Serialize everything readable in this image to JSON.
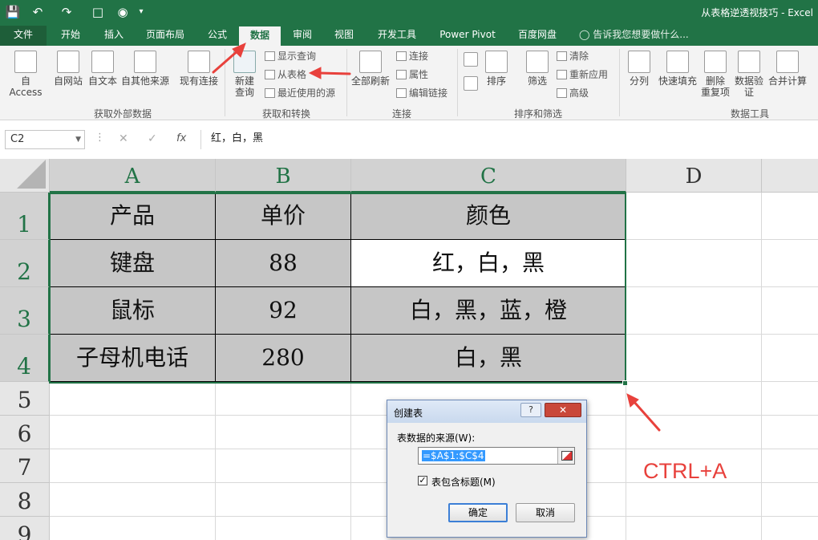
{
  "window": {
    "title": "从表格逆透视技巧 - Excel"
  },
  "ribbon_tabs": [
    "文件",
    "开始",
    "插入",
    "页面布局",
    "公式",
    "数据",
    "审阅",
    "视图",
    "开发工具",
    "Power Pivot",
    "百度网盘"
  ],
  "active_tab": "数据",
  "tell_me": "告诉我您想要做什么...",
  "ribbon": {
    "external": {
      "buttons": [
        "自 Access",
        "自网站",
        "自文本",
        "自其他来源",
        "现有连接"
      ],
      "label": "获取外部数据"
    },
    "transform": {
      "new_query_line1": "新建",
      "new_query_line2": "查询",
      "show_queries": "显示查询",
      "from_table": "从表格",
      "recent_sources": "最近使用的源",
      "label": "获取和转换"
    },
    "connections": {
      "refresh_all": "全部刷新",
      "connections": "连接",
      "properties": "属性",
      "edit_links": "编辑链接",
      "label": "连接"
    },
    "sort_filter": {
      "sort": "排序",
      "filter": "筛选",
      "clear": "清除",
      "reapply": "重新应用",
      "advanced": "高级",
      "label": "排序和筛选"
    },
    "data_tools": {
      "split": "分列",
      "flash_fill": "快速填充",
      "remove_dup_line1": "删除",
      "remove_dup_line2": "重复项",
      "validation_line1": "数据验",
      "validation_line2": "证",
      "consolidate": "合并计算",
      "label": "数据工具"
    }
  },
  "formula_bar": {
    "name_box": "C2",
    "fx": "fx",
    "formula": "红，白，黑"
  },
  "columns": [
    "A",
    "B",
    "C",
    "D"
  ],
  "rows": [
    "1",
    "2",
    "3",
    "4",
    "5",
    "6",
    "7",
    "8",
    "9"
  ],
  "table": [
    [
      "产品",
      "单价",
      "颜色"
    ],
    [
      "键盘",
      "88",
      "红，白，黑"
    ],
    [
      "鼠标",
      "92",
      "白，黑，蓝，橙"
    ],
    [
      "子母机电话",
      "280",
      "白，黑"
    ]
  ],
  "dialog": {
    "title": "创建表",
    "help": "?",
    "close": "✕",
    "source_label": "表数据的来源(W):",
    "source_range": "=$A$1:$C$4",
    "has_headers_label": "表包含标题(M)",
    "has_headers_checked": true,
    "check_mark": "✓",
    "ok": "确定",
    "cancel": "取消"
  },
  "annotation": {
    "text": "CTRL+A",
    "color": "#e8413c"
  },
  "colors": {
    "excel_green": "#217346",
    "header_fill": "#c6c6c6"
  }
}
